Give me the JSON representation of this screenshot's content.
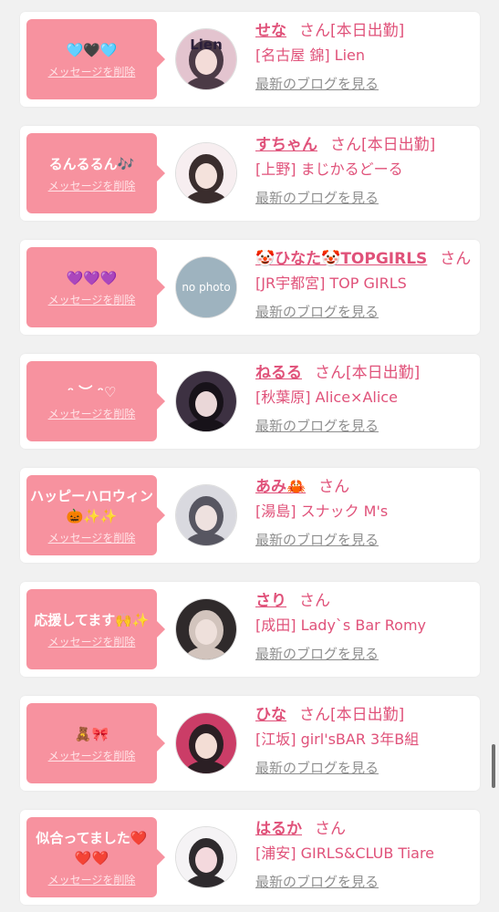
{
  "delete_label": "メッセージを削除",
  "blog_label": "最新のブログを見る",
  "honorific": "さん",
  "colors": {
    "background": "#f1f1f1",
    "bubble": "#f7929f",
    "accent_text": "#e0527a",
    "link_gray": "#8f8f8f"
  },
  "cards": [
    {
      "message": "🩵🖤🩵",
      "name": "せな",
      "status": "[本日出勤]",
      "shop": "[名古屋 錦] Lien",
      "avatar_text": "Lien"
    },
    {
      "message": "るんるるん🎶",
      "name": "すちゃん",
      "status": "[本日出勤]",
      "shop": "[上野] まじかるどーる",
      "avatar_text": ""
    },
    {
      "message": "💜💜💜",
      "name": "🤡ひなた🤡TOPGIRLS",
      "status": "",
      "shop": "[JR宇都宮] TOP GIRLS",
      "avatar_text": "no photo"
    },
    {
      "message": "ᵔ ︶ ᵔ♡",
      "name": "ねるる",
      "status": "[本日出勤]",
      "shop": "[秋葉原] Alice×Alice",
      "avatar_text": ""
    },
    {
      "message": "ハッピーハロウィン🎃✨✨",
      "name": "あみ🦀",
      "status": "",
      "shop": "[湯島] スナック M's",
      "avatar_text": ""
    },
    {
      "message": "応援してます🙌✨",
      "name": "さり",
      "status": "",
      "shop": "[成田] Lady`s Bar Romy",
      "avatar_text": ""
    },
    {
      "message": "🧸🎀",
      "name": "ひな",
      "status": "[本日出勤]",
      "shop": "[江坂] girl'sBAR 3年B組",
      "avatar_text": ""
    },
    {
      "message": "似合ってました❤️❤️❤️",
      "name": "はるか",
      "status": "",
      "shop": "[浦安] GIRLS&CLUB Tiare",
      "avatar_text": ""
    }
  ]
}
